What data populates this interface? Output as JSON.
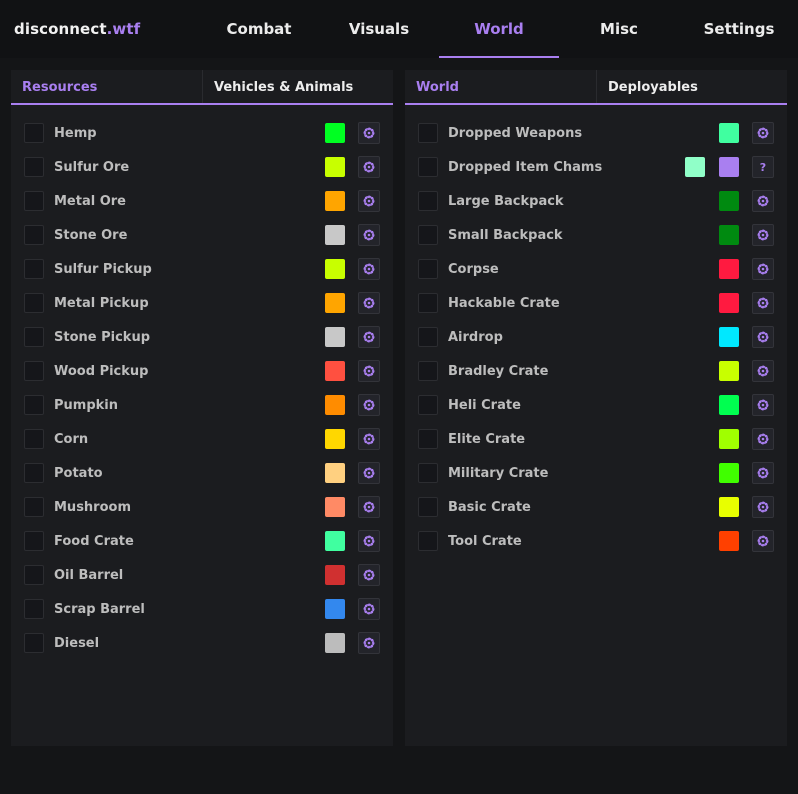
{
  "brand": {
    "name": "disconnect",
    "suffix": ".wtf"
  },
  "nav": {
    "tabs": [
      "Combat",
      "Visuals",
      "World",
      "Misc",
      "Settings"
    ],
    "active": "World"
  },
  "colors": {
    "accent": "#a97ff0",
    "background": "#141517",
    "panel": "#1b1c1f"
  },
  "left_panel": {
    "tabs": [
      "Resources",
      "Vehicles & Animals"
    ],
    "active": "Resources",
    "items": [
      {
        "label": "Hemp",
        "colors": [
          "#00ff22"
        ],
        "action": "spinner-icon"
      },
      {
        "label": "Sulfur Ore",
        "colors": [
          "#c8ff00"
        ],
        "action": "spinner-icon"
      },
      {
        "label": "Metal Ore",
        "colors": [
          "#ffa500"
        ],
        "action": "spinner-icon"
      },
      {
        "label": "Stone Ore",
        "colors": [
          "#c8c8c8"
        ],
        "action": "spinner-icon"
      },
      {
        "label": "Sulfur Pickup",
        "colors": [
          "#c8ff00"
        ],
        "action": "spinner-icon"
      },
      {
        "label": "Metal Pickup",
        "colors": [
          "#ffa500"
        ],
        "action": "spinner-icon"
      },
      {
        "label": "Stone Pickup",
        "colors": [
          "#c8c8c8"
        ],
        "action": "spinner-icon"
      },
      {
        "label": "Wood Pickup",
        "colors": [
          "#ff5040"
        ],
        "action": "spinner-icon"
      },
      {
        "label": "Pumpkin",
        "colors": [
          "#ff8c00"
        ],
        "action": "spinner-icon"
      },
      {
        "label": "Corn",
        "colors": [
          "#ffd700"
        ],
        "action": "spinner-icon"
      },
      {
        "label": "Potato",
        "colors": [
          "#ffd080"
        ],
        "action": "spinner-icon"
      },
      {
        "label": "Mushroom",
        "colors": [
          "#ff8a65"
        ],
        "action": "spinner-icon"
      },
      {
        "label": "Food Crate",
        "colors": [
          "#40ffa0"
        ],
        "action": "spinner-icon"
      },
      {
        "label": "Oil Barrel",
        "colors": [
          "#d03030"
        ],
        "action": "spinner-icon"
      },
      {
        "label": "Scrap Barrel",
        "colors": [
          "#3388ee"
        ],
        "action": "spinner-icon"
      },
      {
        "label": "Diesel",
        "colors": [
          "#bcbcbc"
        ],
        "action": "spinner-icon"
      }
    ]
  },
  "right_panel": {
    "tabs": [
      "World",
      "Deployables"
    ],
    "active": "World",
    "items": [
      {
        "label": "Dropped Weapons",
        "colors": [
          "#40ffa0"
        ],
        "action": "spinner-icon"
      },
      {
        "label": "Dropped Item Chams",
        "colors": [
          "#90ffc8",
          "#a97ff0"
        ],
        "action": "help-icon",
        "action_text": "?"
      },
      {
        "label": "Large Backpack",
        "colors": [
          "#008a10"
        ],
        "action": "spinner-icon"
      },
      {
        "label": "Small Backpack",
        "colors": [
          "#008a10"
        ],
        "action": "spinner-icon"
      },
      {
        "label": "Corpse",
        "colors": [
          "#ff1a40"
        ],
        "action": "spinner-icon"
      },
      {
        "label": "Hackable Crate",
        "colors": [
          "#ff1a40"
        ],
        "action": "spinner-icon"
      },
      {
        "label": "Airdrop",
        "colors": [
          "#00e8ff"
        ],
        "action": "spinner-icon"
      },
      {
        "label": "Bradley Crate",
        "colors": [
          "#c8ff00"
        ],
        "action": "spinner-icon"
      },
      {
        "label": "Heli Crate",
        "colors": [
          "#00ff50"
        ],
        "action": "spinner-icon"
      },
      {
        "label": "Elite Crate",
        "colors": [
          "#a0ff00"
        ],
        "action": "spinner-icon"
      },
      {
        "label": "Military Crate",
        "colors": [
          "#40ff00"
        ],
        "action": "spinner-icon"
      },
      {
        "label": "Basic Crate",
        "colors": [
          "#e8ff00"
        ],
        "action": "spinner-icon"
      },
      {
        "label": "Tool Crate",
        "colors": [
          "#ff4000"
        ],
        "action": "spinner-icon"
      }
    ]
  }
}
